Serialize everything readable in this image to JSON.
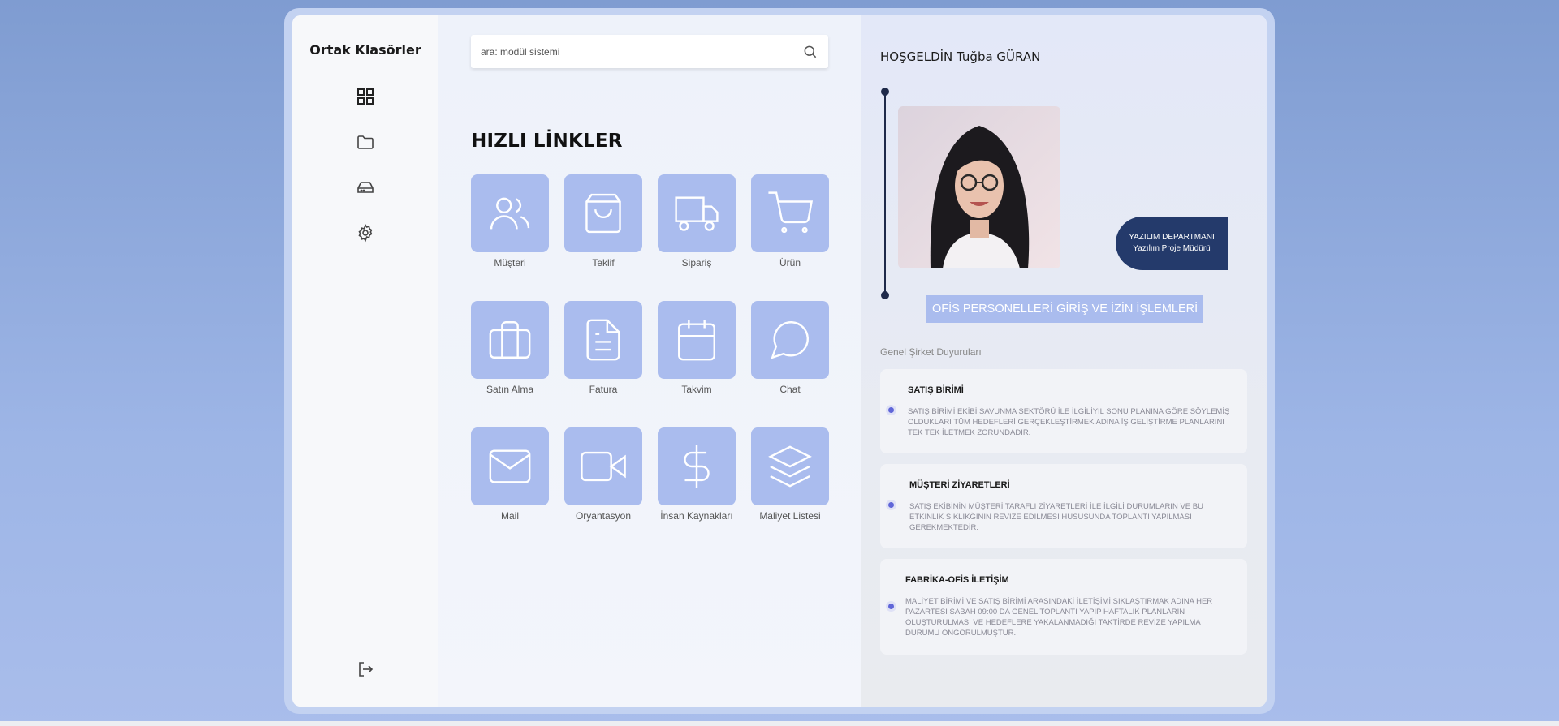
{
  "sidebar": {
    "brand": "Ortak Klasörler",
    "items": [
      {
        "icon": "grid-icon"
      },
      {
        "icon": "folder-icon"
      },
      {
        "icon": "drive-icon"
      },
      {
        "icon": "settings-icon"
      }
    ],
    "logout_icon": "logout-icon"
  },
  "search": {
    "placeholder": "ara: modül sistemi"
  },
  "quick_links": {
    "title": "HIZLI LİNKLER",
    "items": [
      {
        "label": "Müşteri",
        "icon": "users-icon"
      },
      {
        "label": "Teklif",
        "icon": "shopping-bag-icon"
      },
      {
        "label": "Sipariş",
        "icon": "truck-icon"
      },
      {
        "label": "Ürün",
        "icon": "cart-icon"
      },
      {
        "label": "Satın Alma",
        "icon": "briefcase-icon"
      },
      {
        "label": "Fatura",
        "icon": "document-icon"
      },
      {
        "label": "Takvim",
        "icon": "calendar-icon"
      },
      {
        "label": "Chat",
        "icon": "chat-icon"
      },
      {
        "label": "Mail",
        "icon": "mail-icon"
      },
      {
        "label": "Oryantasyon",
        "icon": "video-icon"
      },
      {
        "label": "İnsan Kaynakları",
        "icon": "dollar-icon"
      },
      {
        "label": "Maliyet Listesi",
        "icon": "layers-icon"
      }
    ]
  },
  "profile": {
    "welcome": "HOŞGELDİN Tuğba GÜRAN",
    "department": "YAZILIM DEPARTMANI",
    "role": "Yazılım Proje Müdürü",
    "staff_button": "OFİS PERSONELLERİ GİRİŞ VE İZİN İŞLEMLERİ"
  },
  "announcements": {
    "title": "Genel Şirket Duyuruları",
    "items": [
      {
        "heading": "SATIŞ BİRİMİ",
        "body": "SATIŞ BİRİMİ EKİBİ SAVUNMA SEKTÖRÜ İLE İLGİLİYIL SONU PLANINA GÖRE SÖYLEMİŞ OLDUKLARI TÜM HEDEFLERİ GERÇEKLEŞTİRMEK ADINA İŞ GELİŞTİRME PLANLARINI TEK TEK İLETMEK ZORUNDADIR."
      },
      {
        "heading": "MÜŞTERİ ZİYARETLERİ",
        "body": "SATIŞ EKİBİNİN MÜŞTERİ TARAFLI ZİYARETLERİ İLE İLGİLİ DURUMLARIN VE BU ETKİNLİK SIKLIKĞININ REVİZE EDİLMESİ HUSUSUNDA TOPLANTI YAPILMASI GEREKMEKTEDİR."
      },
      {
        "heading": "FABRİKA-OFİS İLETİŞİM",
        "body": "MALİYET BİRİMİ VE SATIŞ BİRİMİ ARASINDAKİ İLETİŞİMİ SIKLAŞTIRMAK ADINA HER PAZARTESİ SABAH 09:00 DA GENEL TOPLANTI YAPIP HAFTALIK PLANLARIN OLUŞTURULMASI VE HEDEFLERE YAKALANMADIĞI TAKTİRDE REVİZE YAPILMA DURUMU ÖNGÖRÜLMÜŞTÜR."
      }
    ]
  },
  "colors": {
    "tile": "#aabcee",
    "badge": "#243a6b",
    "accent_dot": "#6066d8"
  }
}
